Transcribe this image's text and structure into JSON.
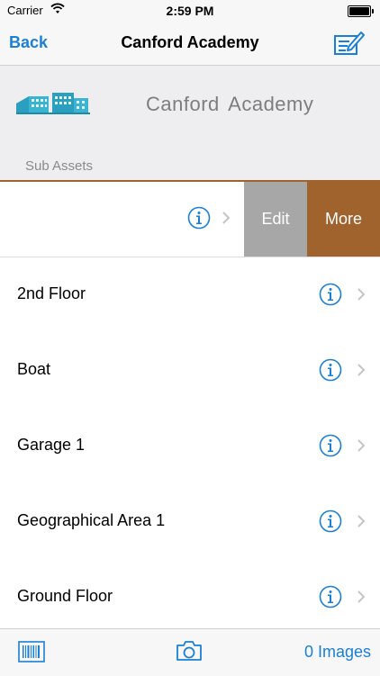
{
  "status_bar": {
    "carrier": "Carrier",
    "time": "2:59 PM"
  },
  "nav": {
    "back_label": "Back",
    "title": "Canford  Academy",
    "edit_icon": "edit-list-icon"
  },
  "header": {
    "asset_name": "Canford  Academy",
    "section_label": "Sub Assets"
  },
  "swipe_row": {
    "label": "",
    "edit_label": "Edit",
    "more_label": "More"
  },
  "rows": [
    {
      "label": "2nd Floor"
    },
    {
      "label": "Boat"
    },
    {
      "label": "Garage 1"
    },
    {
      "label": "Geographical Area 1"
    },
    {
      "label": "Ground Floor"
    }
  ],
  "toolbar": {
    "images_label": "0 Images"
  },
  "colors": {
    "accent": "#1a7fd6",
    "more": "#a0632e",
    "edit": "#a7a7a7",
    "separator": "#a0632e"
  }
}
